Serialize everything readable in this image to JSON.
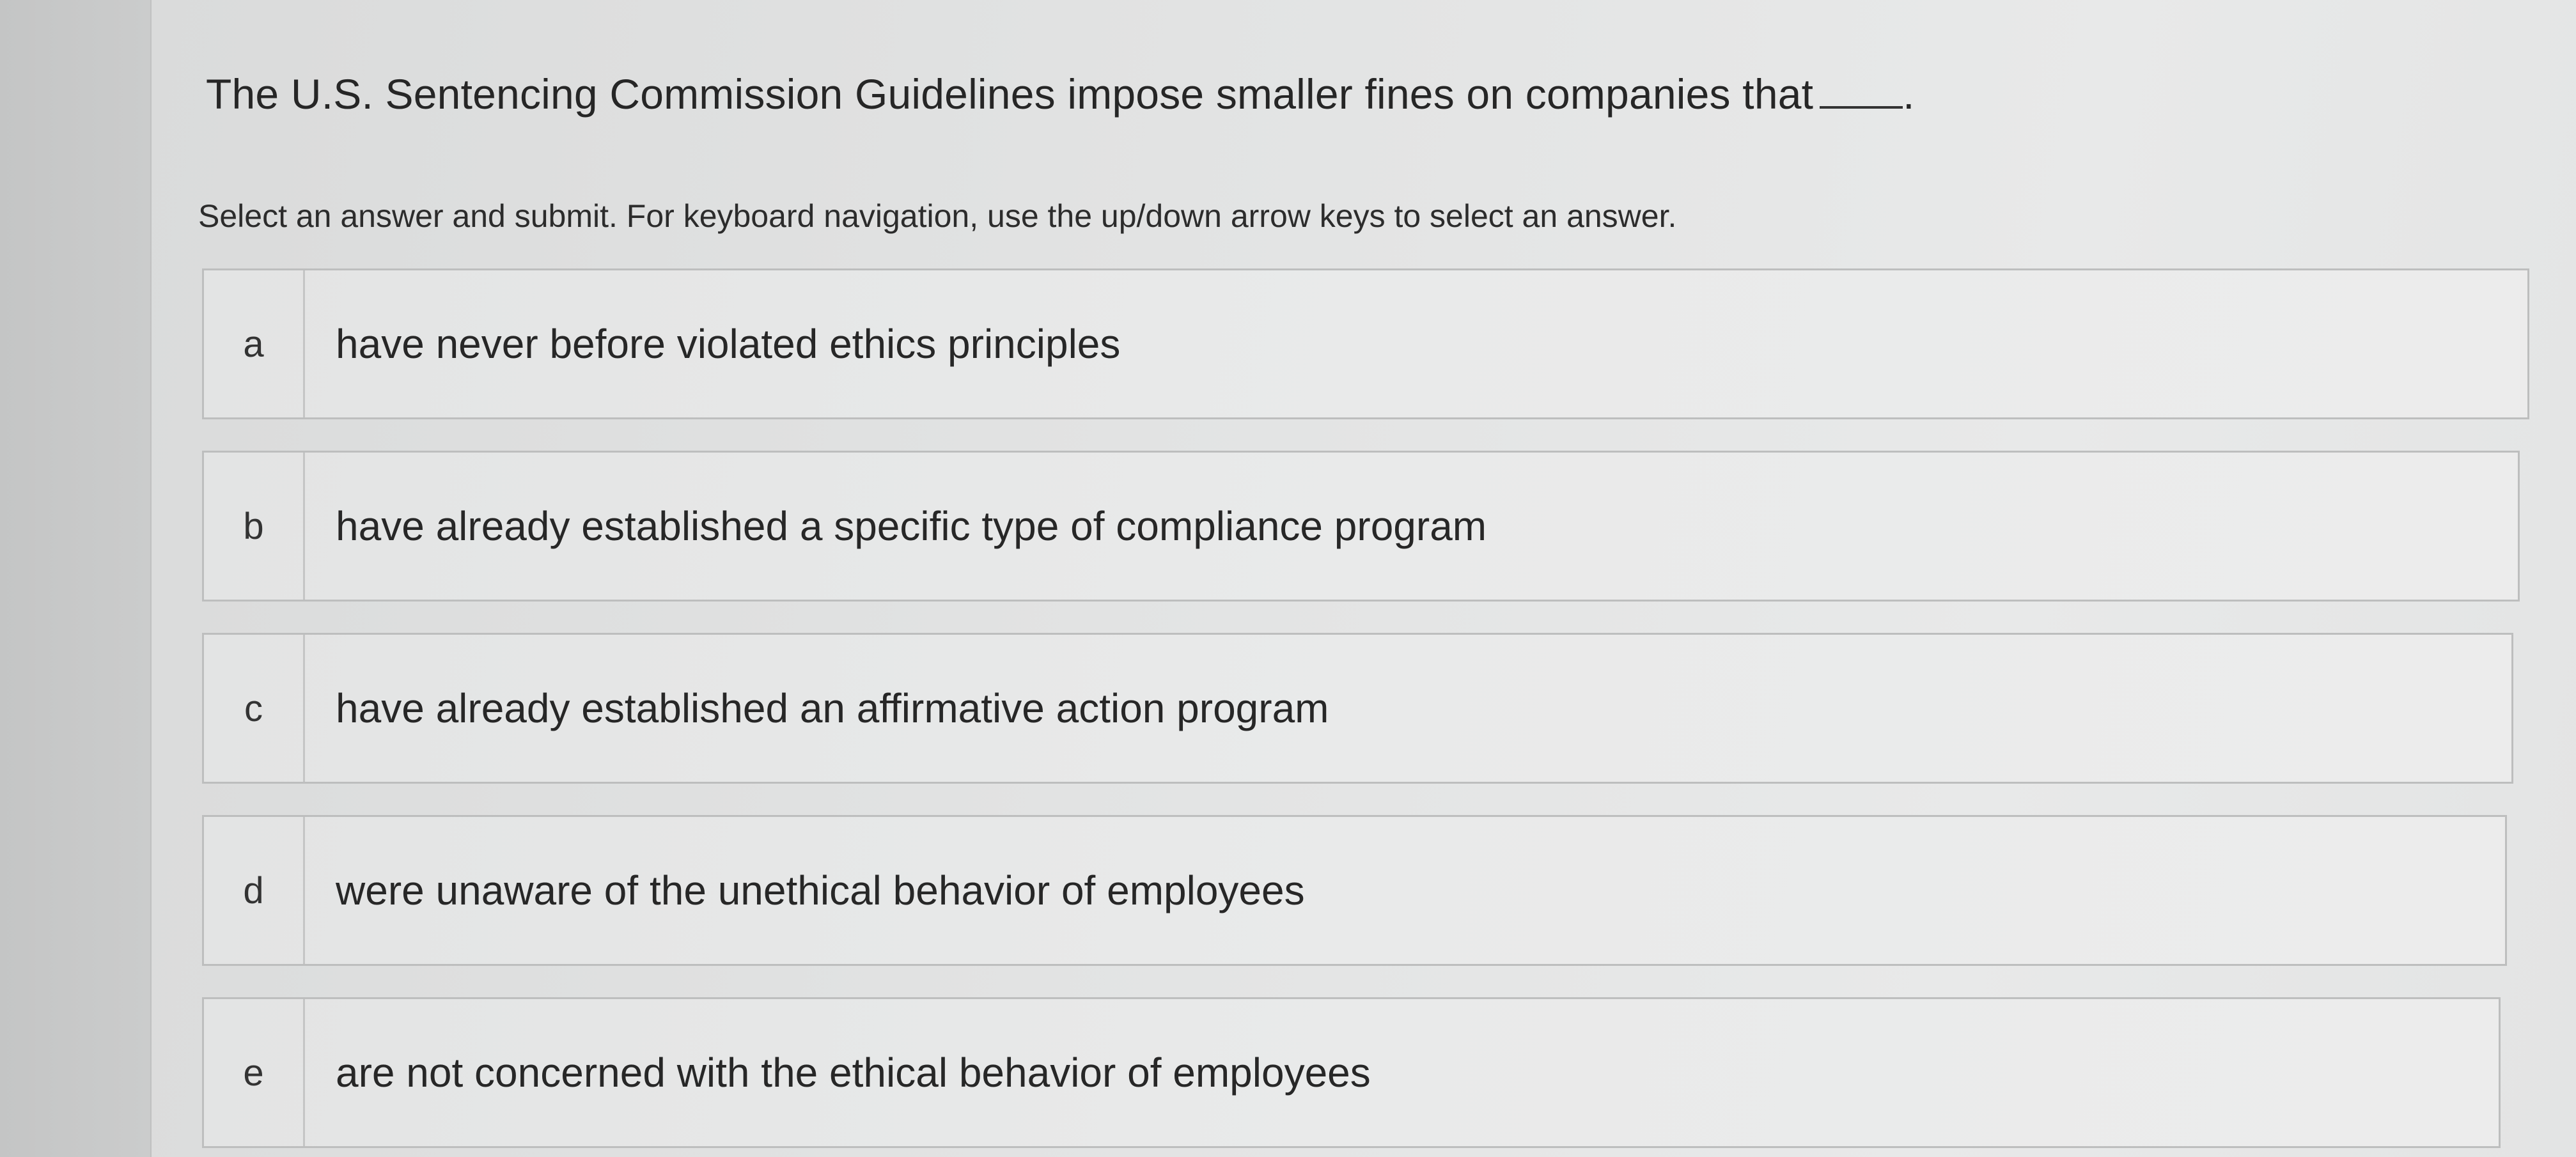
{
  "question": {
    "text": "The U.S. Sentencing Commission Guidelines impose smaller fines on companies that",
    "suffix": "."
  },
  "instructions": "Select an answer and submit. For keyboard navigation, use the up/down arrow keys to select an answer.",
  "answers": [
    {
      "letter": "a",
      "text": "have never before violated ethics principles"
    },
    {
      "letter": "b",
      "text": "have already established a specific type of compliance program"
    },
    {
      "letter": "c",
      "text": "have already established an affirmative action program"
    },
    {
      "letter": "d",
      "text": "were unaware of the unethical behavior of employees"
    },
    {
      "letter": "e",
      "text": "are not concerned with the ethical behavior of employees"
    }
  ]
}
